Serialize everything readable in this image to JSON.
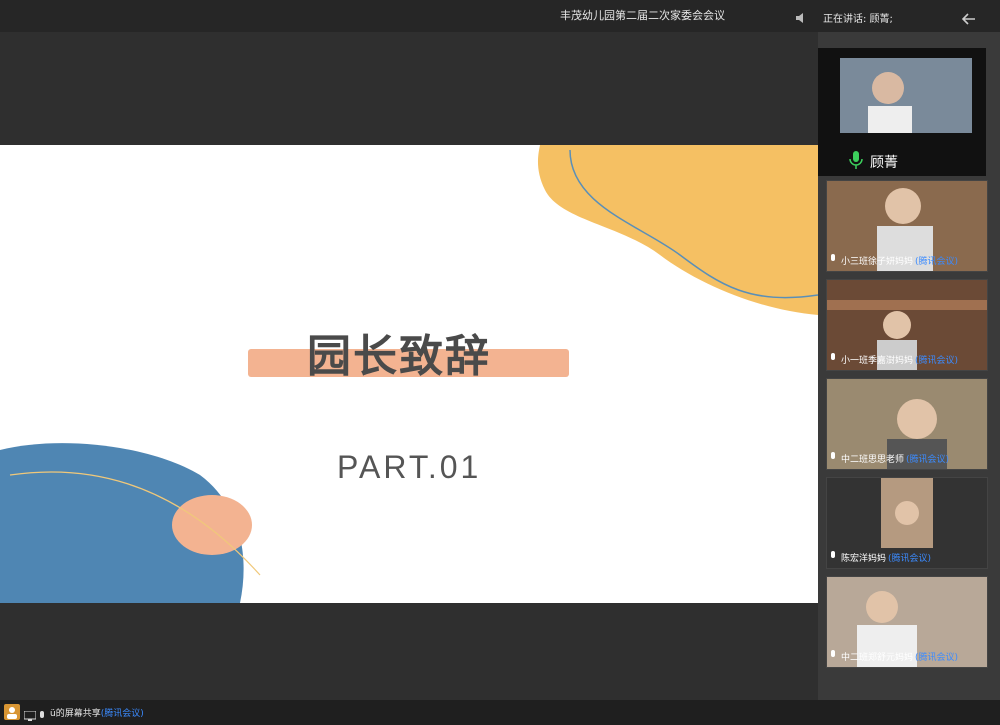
{
  "header": {
    "meeting_title": "丰茂幼儿园第二届二次家委会会议",
    "speaking_label": "正在讲话: 顾菁;"
  },
  "slide": {
    "title": "园长致辞",
    "subtitle": "PART.01"
  },
  "active_speaker": {
    "name": "顾菁"
  },
  "participants": [
    {
      "name": "小三班徐子妍妈妈",
      "badge": "(腾讯会议)"
    },
    {
      "name": "小一班季嘉澍妈妈",
      "badge": "(腾讯会议)"
    },
    {
      "name": "中二班思思老师",
      "badge": "(腾讯会议)"
    },
    {
      "name": "陈宏洋妈妈",
      "badge": "(腾讯会议)"
    },
    {
      "name": "中二班郑舒元妈妈",
      "badge": "(腾讯会议)"
    }
  ],
  "footer": {
    "share_text": "ü的屏幕共享",
    "share_badge": "(腾讯会议)"
  },
  "colors": {
    "accent_orange": "#f5c063",
    "accent_salmon": "#f3b391",
    "accent_blue": "#4f86b3",
    "badge_blue": "#3b8bff"
  }
}
